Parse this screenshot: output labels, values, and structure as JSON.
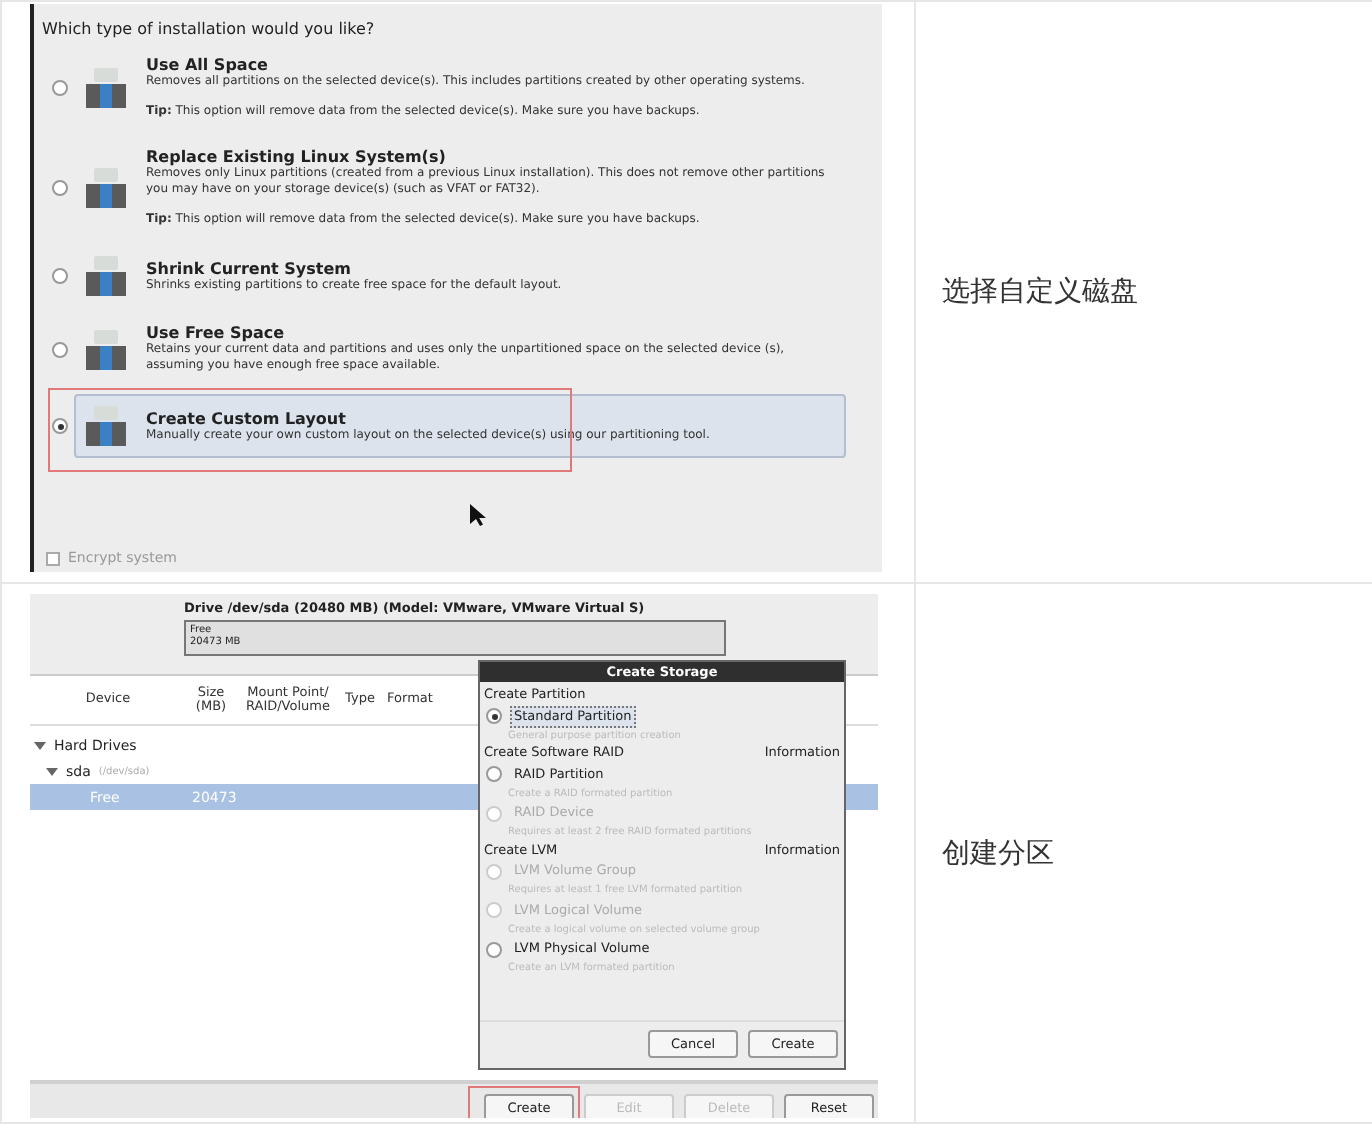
{
  "rows": [
    {
      "kind": "install",
      "caption": "选择自定义磁盘",
      "install": {
        "question": "Which type of installation would you like?",
        "options": [
          {
            "title": "Use All Space",
            "description": "Removes all partitions on the selected device(s).  This includes partitions created by other operating systems.",
            "tip_label": "Tip:",
            "tip": "This option will remove data from the selected device(s).  Make sure you have backups.",
            "selected": false,
            "highlighted": false
          },
          {
            "title": "Replace Existing Linux System(s)",
            "description": "Removes only Linux partitions (created from a previous Linux installation).  This does not remove other partitions you may have on your storage device(s) (such as VFAT or FAT32).",
            "tip_label": "Tip:",
            "tip": "This option will remove data from the selected device(s).  Make sure you have backups.",
            "selected": false,
            "highlighted": false
          },
          {
            "title": "Shrink Current System",
            "description": "Shrinks existing partitions to create free space for the default layout.",
            "selected": false,
            "highlighted": false
          },
          {
            "title": "Use Free Space",
            "description": "Retains your current data and partitions and uses only the unpartitioned space on the selected device (s), assuming you have enough free space available.",
            "selected": false,
            "highlighted": false
          },
          {
            "title": "Create Custom Layout",
            "description": "Manually create your own custom layout on the selected device(s) using our partitioning tool.",
            "selected": true,
            "highlighted": true
          }
        ],
        "encrypt": {
          "label": "Encrypt system",
          "checked": false,
          "disabled": true
        }
      }
    },
    {
      "kind": "partition",
      "caption": "创建分区",
      "partition": {
        "drive_title": "Drive /dev/sda (20480 MB) (Model: VMware, VMware Virtual S)",
        "segment": {
          "label": "Free",
          "size": "20473 MB"
        },
        "columns": [
          "Device",
          "Size (MB)",
          "Mount Point/ RAID/Volume",
          "Type",
          "Format"
        ],
        "tree": [
          {
            "label": "Hard Drives",
            "expanded": true,
            "children": [
              {
                "label": "sda",
                "sublabel": "(/dev/sda)",
                "expanded": true,
                "children": [
                  {
                    "label": "Free",
                    "size": "20473",
                    "selected": true
                  }
                ]
              }
            ]
          }
        ],
        "dialog": {
          "title": "Create Storage",
          "sections": [
            {
              "heading": "Create Partition",
              "options": [
                {
                  "label": "Standard Partition",
                  "hint": "General purpose partition creation",
                  "selected": true,
                  "disabled": false
                }
              ]
            },
            {
              "heading": "Create Software RAID",
              "info": "Information",
              "options": [
                {
                  "label": "RAID Partition",
                  "hint": "Create a RAID formated partition",
                  "selected": false,
                  "disabled": false
                },
                {
                  "label": "RAID Device",
                  "hint": "Requires at least 2 free RAID formated partitions",
                  "selected": false,
                  "disabled": true
                }
              ]
            },
            {
              "heading": "Create LVM",
              "info": "Information",
              "options": [
                {
                  "label": "LVM Volume Group",
                  "hint": "Requires at least 1 free LVM formated partition",
                  "selected": false,
                  "disabled": true
                },
                {
                  "label": "LVM Logical Volume",
                  "hint": "Create a logical volume on selected volume group",
                  "selected": false,
                  "disabled": true
                },
                {
                  "label": "LVM Physical Volume",
                  "hint": "Create an LVM formated partition",
                  "selected": false,
                  "disabled": false
                }
              ]
            }
          ],
          "buttons": [
            "Cancel",
            "Create"
          ]
        },
        "buttons": [
          {
            "label": "Create",
            "disabled": false,
            "highlighted": true
          },
          {
            "label": "Edit",
            "disabled": true,
            "highlighted": false
          },
          {
            "label": "Delete",
            "disabled": true,
            "highlighted": false
          },
          {
            "label": "Reset",
            "disabled": false,
            "highlighted": false
          }
        ]
      }
    }
  ]
}
